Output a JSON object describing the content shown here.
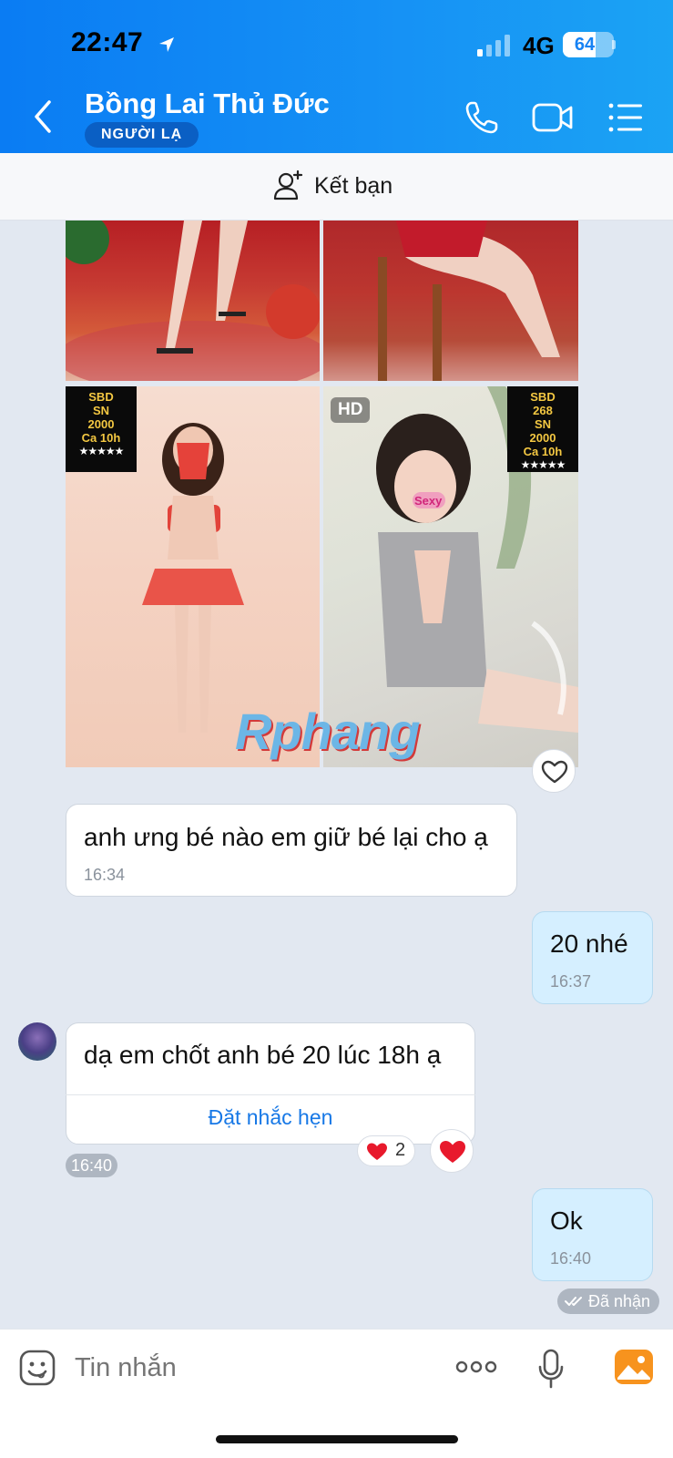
{
  "status_bar": {
    "time": "22:47",
    "network": "4G",
    "battery": "64",
    "battery_level": 0.64
  },
  "header": {
    "title": "Bồng Lai Thủ Đức",
    "badge": "NGƯỜI LẠ"
  },
  "friend_bar": {
    "label": "Kết bạn"
  },
  "images": {
    "hd_label": "HD",
    "promo_left": {
      "line1": "SBD",
      "line2": "",
      "line3": "SN",
      "line4": "2000",
      "line5": "Ca 10h",
      "stars": "★★★★★"
    },
    "promo_right": {
      "line1": "SBD",
      "line2": "268",
      "line3": "SN",
      "line4": "2000",
      "line5": "Ca 10h",
      "stars": "★★★★★"
    },
    "watermark": "Rphang",
    "sticker": "Sexy"
  },
  "messages": [
    {
      "text": "anh ưng bé nào em giữ bé lại cho ạ",
      "time": "16:34",
      "direction": "in"
    },
    {
      "text": "20 nhé",
      "time": "16:37",
      "direction": "out"
    },
    {
      "text": "dạ em chốt anh bé 20 lúc 18h ạ",
      "time": "16:40",
      "direction": "in",
      "action": "Đặt nhắc hẹn",
      "reaction_count": "2"
    },
    {
      "text": "Ok",
      "time": "16:40",
      "direction": "out"
    }
  ],
  "delivery_status": "Đã nhận",
  "input": {
    "placeholder": "Tin nhắn"
  },
  "colors": {
    "header": "#0a7cf3",
    "link": "#1778e6",
    "outgoing_bubble": "#d5efff",
    "heart": "#e8192c"
  }
}
